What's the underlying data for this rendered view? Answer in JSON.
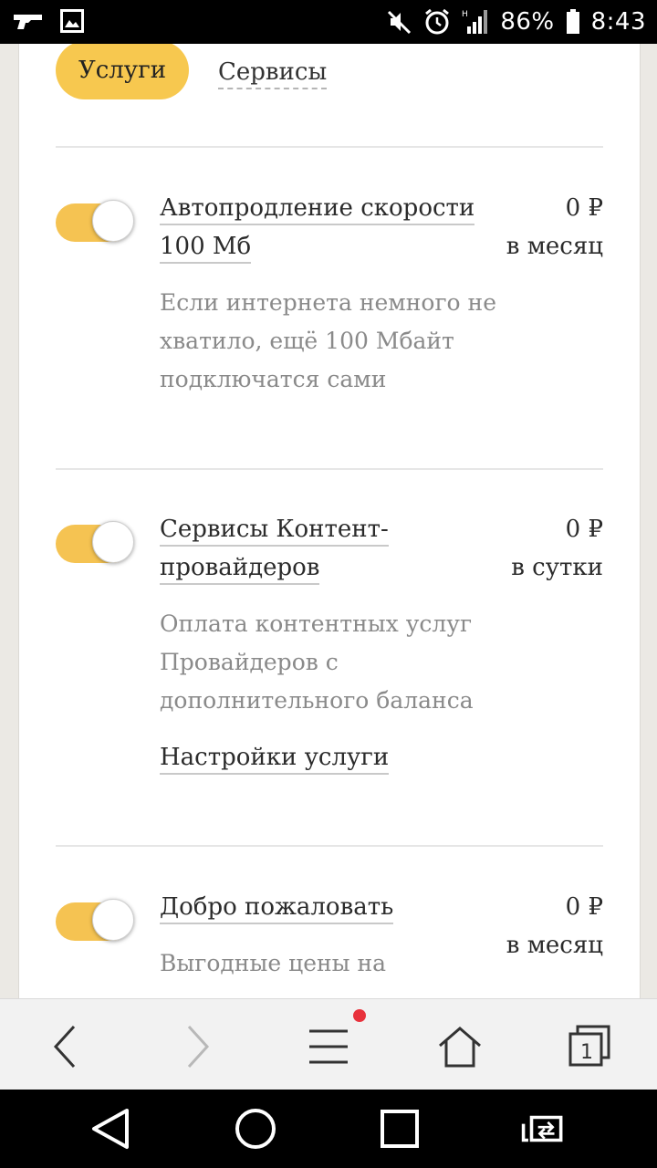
{
  "status_bar": {
    "battery": "86%",
    "time": "8:43",
    "network_type": "H",
    "icons": [
      "gun-icon",
      "image-icon",
      "mute-icon",
      "alarm-icon",
      "signal-icon",
      "battery-icon"
    ]
  },
  "tabs": {
    "active": "Услуги",
    "inactive": "Сервисы"
  },
  "services": [
    {
      "title_line1": "Автопродление скорости",
      "title_line2": "100 Мб",
      "price": "0 ₽",
      "period": "в месяц",
      "description": [
        "Если интернета немного не",
        "хватило, ещё 100 Мбайт",
        "подключатся сами"
      ],
      "enabled": true
    },
    {
      "title_line1": "Сервисы Контент-",
      "title_line2": "провайдеров",
      "price": "0 ₽",
      "period": "в сутки",
      "description": [
        "Оплата контентных услуг",
        "Провайдеров с",
        "дополнительного баланса"
      ],
      "settings_link": "Настройки услуги",
      "enabled": true
    },
    {
      "title_line1": "Добро пожаловать",
      "price": "0 ₽",
      "period": "в месяц",
      "description": [
        "Выгодные цены на"
      ],
      "enabled": true
    }
  ],
  "browser_bar": {
    "tab_count": "1",
    "icons": [
      "back-icon",
      "forward-icon",
      "menu-icon",
      "home-icon",
      "tabs-icon"
    ]
  },
  "colors": {
    "accent": "#f7c84f",
    "toggle_on": "#f5c352",
    "notification_dot": "#e8323c"
  }
}
